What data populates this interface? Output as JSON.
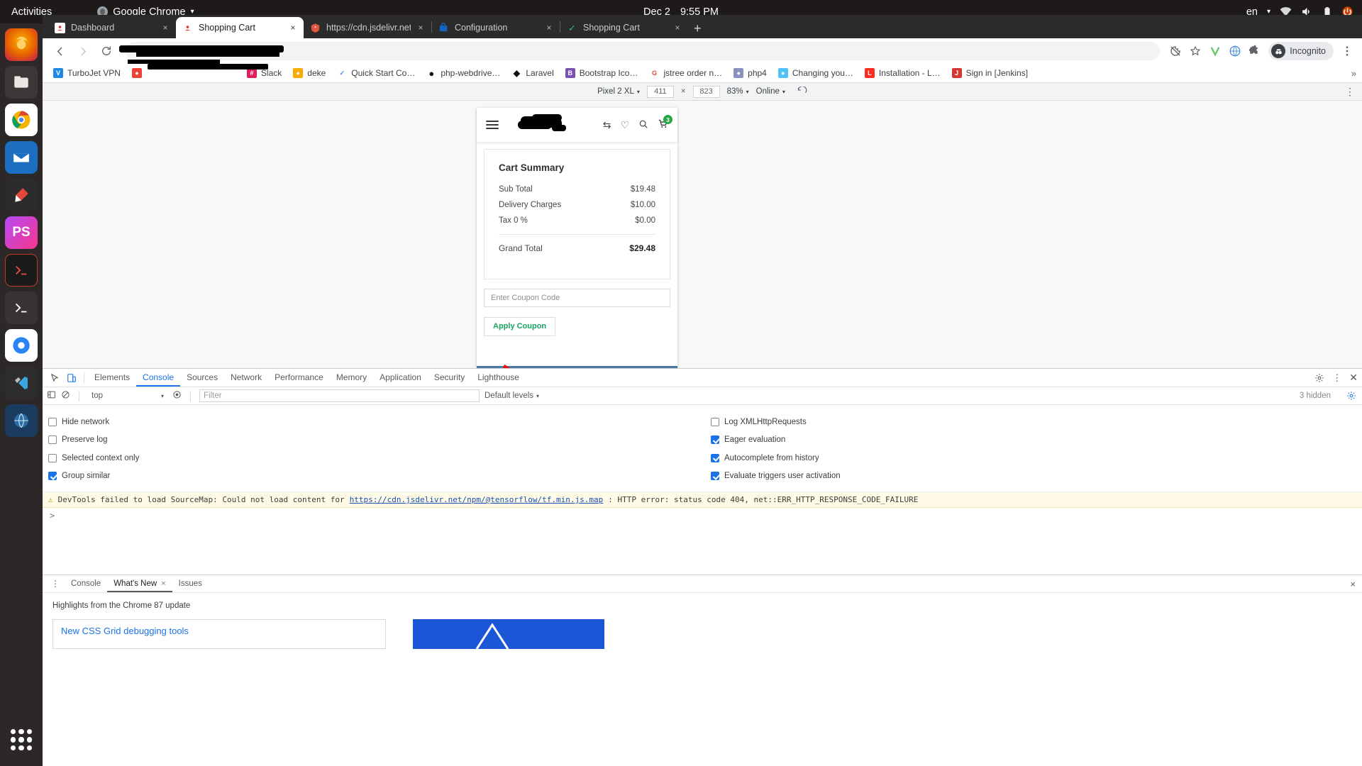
{
  "os": {
    "activities": "Activities",
    "active_app": "Google Chrome",
    "app_caret": "▾",
    "clock_date": "Dec 2",
    "clock_time": "9:55 PM",
    "keyboard_layout": "en",
    "tray_icons": [
      "network-icon",
      "volume-icon",
      "battery-icon",
      "power-icon"
    ],
    "dock_items": [
      {
        "name": "firefox",
        "label": "Firefox",
        "color": "#e66000"
      },
      {
        "name": "files",
        "label": "Files",
        "color": "#e8e6e3"
      },
      {
        "name": "chrome",
        "label": "Chrome",
        "color": "#ffffff"
      },
      {
        "name": "thunderbird",
        "label": "Thunderbird",
        "color": "#1f6fd0"
      },
      {
        "name": "inkscape",
        "label": "Inkscape",
        "color": "#d13b3b"
      },
      {
        "name": "phpstorm",
        "label": "PhpStorm",
        "color": "#b74af7"
      },
      {
        "name": "terminator",
        "label": "Terminator",
        "color": "#2b2b2b"
      },
      {
        "name": "terminal",
        "label": "Terminal",
        "color": "#333333"
      },
      {
        "name": "chrome-dev",
        "label": "Chrome Dev",
        "color": "#2a84f5"
      },
      {
        "name": "vscode",
        "label": "Visual Studio Code",
        "color": "#23272e"
      },
      {
        "name": "globe",
        "label": "Globe",
        "color": "#2a5a8a"
      },
      {
        "name": "show-apps",
        "label": "Show Applications",
        "color": "#ffffff"
      }
    ]
  },
  "browser": {
    "tabs": [
      {
        "title": "Dashboard",
        "favicon": "#e53935",
        "active": false,
        "close": "×"
      },
      {
        "title": "Shopping Cart",
        "favicon": "#e53935",
        "active": true,
        "close": "×"
      },
      {
        "title": "https://cdn.jsdelivr.net/n",
        "favicon": "#e5543c",
        "active": false,
        "close": "×"
      },
      {
        "title": "Configuration",
        "favicon": "#1565c0",
        "active": false,
        "close": "×"
      },
      {
        "title": "Shopping Cart",
        "favicon": "#22c07a",
        "active": false,
        "close": "×"
      }
    ],
    "new_tab_label": "+",
    "nav": {
      "back": "←",
      "forward": "→",
      "reload": "↻"
    },
    "omnibox_value": "",
    "omnibox_placeholder": "",
    "toolbar_icons": [
      "blocked-cookies-icon",
      "bookmark-star-icon",
      "extension-v-icon",
      "extension-globe-icon",
      "extensions-puzzle-icon",
      "chrome-menu-icon"
    ],
    "incognito_label": "Incognito",
    "bookmarks": [
      {
        "label": "TurboJet VPN",
        "icon_color": "#1e88e5",
        "icon_glyph": "V"
      },
      {
        "label": "",
        "icon_color": "#ea4335",
        "icon_glyph": "",
        "redacted": true
      },
      {
        "label": "Slack",
        "icon_color": "#e01e5a",
        "icon_glyph": "#"
      },
      {
        "label": "deke",
        "icon_color": "#f9ab00",
        "icon_glyph": "●"
      },
      {
        "label": "Quick Start Co…",
        "icon_color": "#4285f4",
        "icon_glyph": "✓"
      },
      {
        "label": "php-webdrive…",
        "icon_color": "#000000",
        "icon_glyph": "●"
      },
      {
        "label": "Laravel",
        "icon_color": "#111111",
        "icon_glyph": "◆"
      },
      {
        "label": "Bootstrap Ico…",
        "icon_color": "#7952b3",
        "icon_glyph": "B"
      },
      {
        "label": "jstree order n…",
        "icon_color": "#ea4335",
        "icon_glyph": "G"
      },
      {
        "label": "php4",
        "icon_color": "#8892bf",
        "icon_glyph": "●"
      },
      {
        "label": "Changing you…",
        "icon_color": "#4fc3f7",
        "icon_glyph": "●"
      },
      {
        "label": "Installation - L…",
        "icon_color": "#ff2d20",
        "icon_glyph": "L"
      },
      {
        "label": "Sign in [Jenkins]",
        "icon_color": "#d33833",
        "icon_glyph": "J"
      }
    ],
    "bookmarks_overflow": "»"
  },
  "device_toolbar": {
    "device_name": "Pixel 2 XL",
    "device_caret": "▾",
    "width": "411",
    "height": "823",
    "times": "×",
    "zoom": "83%",
    "zoom_caret": "▾",
    "throttling": "Online",
    "throttling_caret": "▾",
    "rotate_icon": "rotate-icon",
    "menu_icon": "more-vertical-icon"
  },
  "page": {
    "header": {
      "menu_icon": "hamburger-menu-icon",
      "logo_alt": "site-logo-redacted",
      "actions": [
        {
          "name": "compare-icon",
          "glyph": "⇆"
        },
        {
          "name": "wishlist-heart-icon",
          "glyph": "♡"
        },
        {
          "name": "search-icon",
          "glyph": "⌕"
        },
        {
          "name": "cart-icon",
          "glyph": "🛒",
          "badge": "3"
        }
      ]
    },
    "cart_summary": {
      "title": "Cart Summary",
      "rows": [
        {
          "label": "Sub Total",
          "value": "$19.48"
        },
        {
          "label": "Delivery Charges",
          "value": "$10.00"
        },
        {
          "label": "Tax 0 %",
          "value": "$0.00"
        }
      ],
      "total_label": "Grand Total",
      "total_value": "$29.48"
    },
    "coupon": {
      "placeholder": "Enter Coupon Code",
      "value": "",
      "apply_label": "Apply Coupon",
      "apply_color": "#1ba361"
    },
    "footer": {
      "nav_count": 4,
      "bg_color": "#4a7aa7"
    }
  },
  "devtools": {
    "inspect_icon": "inspect-element-icon",
    "device_toggle_icon": "device-toolbar-icon",
    "tabs": [
      "Elements",
      "Console",
      "Sources",
      "Network",
      "Performance",
      "Memory",
      "Application",
      "Security",
      "Lighthouse"
    ],
    "active_tab": "Console",
    "right_icons": [
      "settings-gear-icon",
      "more-vertical-icon",
      "close-icon"
    ],
    "console_bar": {
      "sidebar_icon": "console-sidebar-icon",
      "clear_icon": "clear-console-icon",
      "context": "top",
      "context_caret": "▾",
      "eye_icon": "live-expression-icon",
      "filter_placeholder": "Filter",
      "filter_value": "",
      "levels": "Default levels",
      "levels_caret": "▾",
      "hidden_count": "3 hidden",
      "settings_icon": "console-settings-gear-icon"
    },
    "settings_left": [
      {
        "label": "Hide network",
        "checked": false
      },
      {
        "label": "Preserve log",
        "checked": false
      },
      {
        "label": "Selected context only",
        "checked": false
      },
      {
        "label": "Group similar",
        "checked": true
      }
    ],
    "settings_right": [
      {
        "label": "Log XMLHttpRequests",
        "checked": false
      },
      {
        "label": "Eager evaluation",
        "checked": true
      },
      {
        "label": "Autocomplete from history",
        "checked": true
      },
      {
        "label": "Evaluate triggers user activation",
        "checked": true
      }
    ],
    "log_entry": {
      "icon": "warning-triangle-icon",
      "prefix": "DevTools failed to load SourceMap: Could not load content for ",
      "link": "https://cdn.jsdelivr.net/npm/@tensorflow/tf.min.js.map",
      "suffix": ": HTTP error: status code 404, net::ERR_HTTP_RESPONSE_CODE_FAILURE"
    },
    "prompt": ">",
    "drawer": {
      "more_icon": "drawer-more-icon",
      "tabs": [
        {
          "label": "Console",
          "active": false,
          "closable": false
        },
        {
          "label": "What's New",
          "active": true,
          "closable": true,
          "close": "×"
        },
        {
          "label": "Issues",
          "active": false,
          "closable": false
        }
      ],
      "close_icon": "×",
      "heading": "Highlights from the Chrome 87 update",
      "cards": [
        {
          "title": "New CSS Grid debugging tools"
        }
      ]
    }
  }
}
